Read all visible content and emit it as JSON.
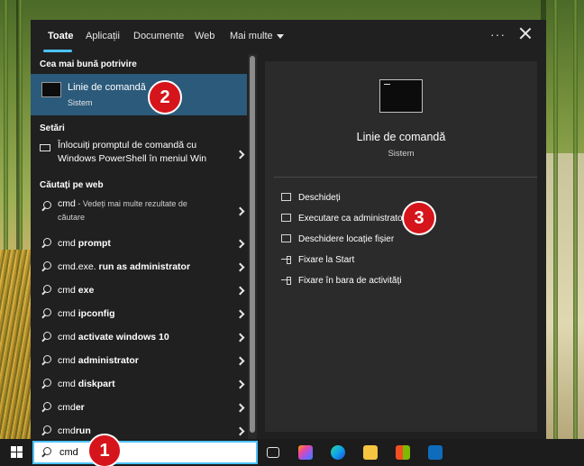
{
  "tabs": [
    "Toate",
    "Aplicații",
    "Documente",
    "Web",
    "Mai multe"
  ],
  "window": {
    "more_dots": "···"
  },
  "sections": {
    "best": "Cea mai bună potrivire",
    "settings": "Setări",
    "web": "Căutați pe web"
  },
  "best_match": {
    "title": "Linie de comandă",
    "subtitle": "Sistem"
  },
  "setting_item": {
    "line1": "Înlocuiți promptul de comandă cu",
    "line2": "Windows PowerShell în meniul Win"
  },
  "web_items": [
    {
      "query": "cmd",
      "suffix": " - Vedeți mai multe rezultate de",
      "suffix2": "căutare"
    },
    {
      "query": "cmd",
      "bold": " prompt"
    },
    {
      "query": "cmd.exe.",
      "bold": " run as administrator"
    },
    {
      "query": "cmd",
      "bold": " exe"
    },
    {
      "query": "cmd",
      "bold": " ipconfig"
    },
    {
      "query": "cmd",
      "bold": " activate windows 10"
    },
    {
      "query": "cmd",
      "bold": " administrator"
    },
    {
      "query": "cmd",
      "bold": " diskpart"
    },
    {
      "query": "cmd",
      "bold": "er"
    },
    {
      "query": "cmd",
      "bold": "run"
    }
  ],
  "detail": {
    "title": "Linie de comandă",
    "subtitle": "Sistem",
    "actions": [
      "Deschideți",
      "Executare ca administrator",
      "Deschidere locație fișier",
      "Fixare la Start",
      "Fixare în bara de activități"
    ]
  },
  "search": {
    "value": "cmd"
  },
  "badges": [
    "1",
    "2",
    "3"
  ],
  "colors": {
    "accent": "#4cc2ff",
    "selection": "#2b5a7a",
    "badge": "#d5151b",
    "panel": "#202020"
  }
}
